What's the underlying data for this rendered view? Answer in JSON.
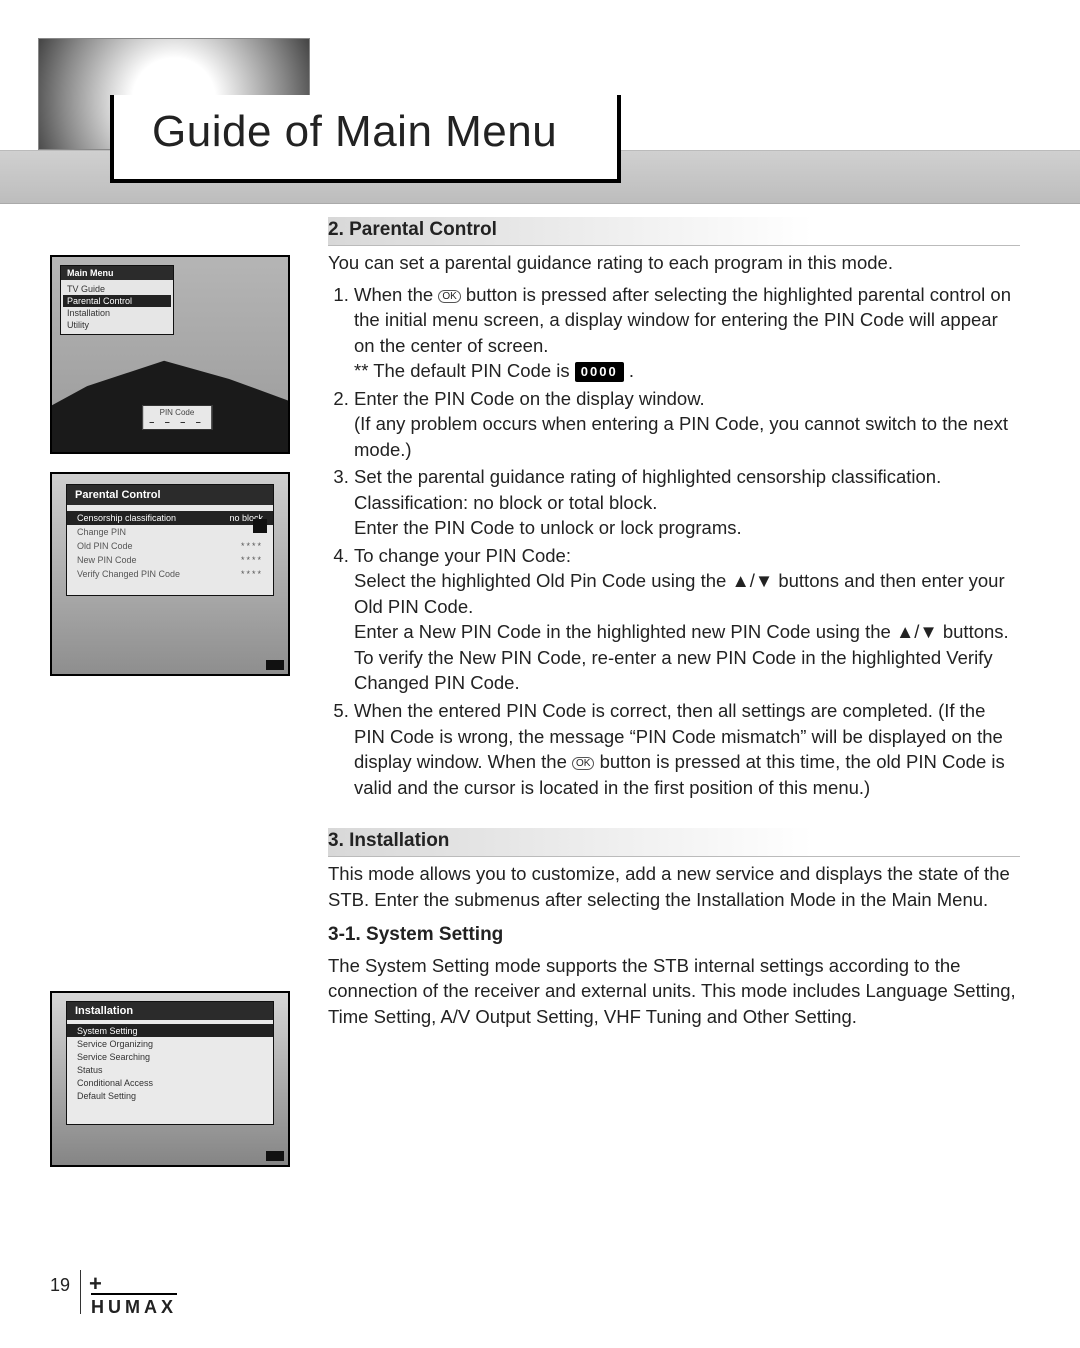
{
  "title": "Guide of Main Menu",
  "page_number": "19",
  "brand": "HUMAX",
  "section_parental": {
    "heading": "2. Parental Control",
    "intro": "You can set a parental guidance rating to each program in this mode.",
    "items": {
      "s1a": "When the ",
      "ok": "OK",
      "s1b": " button is pressed after selecting the highlighted parental control on the initial menu screen, a display window for entering the PIN Code will appear on the center of screen.",
      "s1c": "** The default PIN Code is ",
      "pin_default": "0000",
      "s1d": " .",
      "s2a": "Enter the PIN Code on the display window.",
      "s2b": "(If any problem occurs when entering a PIN Code, you cannot switch to the next mode.)",
      "s3a": "Set the parental guidance rating of highlighted censorship classification.",
      "s3b": "Classification: no block or total block.",
      "s3c": "Enter the PIN Code to unlock or lock programs.",
      "s4a": "To change your PIN Code:",
      "s4b": "Select the highlighted Old Pin Code using the  ▲/▼  buttons and then enter your Old PIN Code.",
      "s4c": "Enter a New PIN Code in the highlighted new PIN Code using the  ▲/▼  buttons.",
      "s4d": "To verify the New PIN Code, re-enter a new PIN Code in the highlighted Verify Changed PIN Code.",
      "s5a": "When the entered PIN Code is correct, then all settings are completed. (If the PIN Code is wrong, the message “PIN Code mismatch” will be displayed on the display window. When the ",
      "s5b": " button is pressed at this time, the old PIN Code is valid and the cursor is located in the first position of this menu.)"
    }
  },
  "section_install": {
    "heading": "3. Installation",
    "intro": "This mode allows you to customize, add a new service and displays the state of the STB. Enter the submenus after selecting the Installation Mode in the Main Menu.",
    "sub_heading": "3-1. System Setting",
    "sub_body": "The System Setting mode supports the STB internal settings according to the connection of the receiver and external units. This mode includes Language Setting, Time Setting, A/V Output Setting, VHF Tuning and Other Setting."
  },
  "shot1": {
    "panel_title": "Main Menu",
    "items": [
      "TV Guide",
      "Parental Control",
      "Installation",
      "Utility"
    ],
    "highlighted": "Parental Control",
    "pin_label": "PIN Code",
    "pin_dashes": "– – – –"
  },
  "shot2": {
    "panel_title": "Parental Control",
    "rows": [
      {
        "label": "Censorship classification",
        "value": "no block",
        "hi": true
      },
      {
        "label": "Change PIN",
        "value": ""
      },
      {
        "label": "Old PIN Code",
        "value": "****"
      },
      {
        "label": "New PIN Code",
        "value": "****"
      },
      {
        "label": "Verify Changed PIN Code",
        "value": "****"
      }
    ]
  },
  "shot3": {
    "panel_title": "Installation",
    "rows": [
      {
        "label": "System Setting",
        "hi": true
      },
      {
        "label": "Service Organizing"
      },
      {
        "label": "Service Searching"
      },
      {
        "label": "Status"
      },
      {
        "label": "Conditional Access"
      },
      {
        "label": "Default Setting"
      }
    ]
  }
}
